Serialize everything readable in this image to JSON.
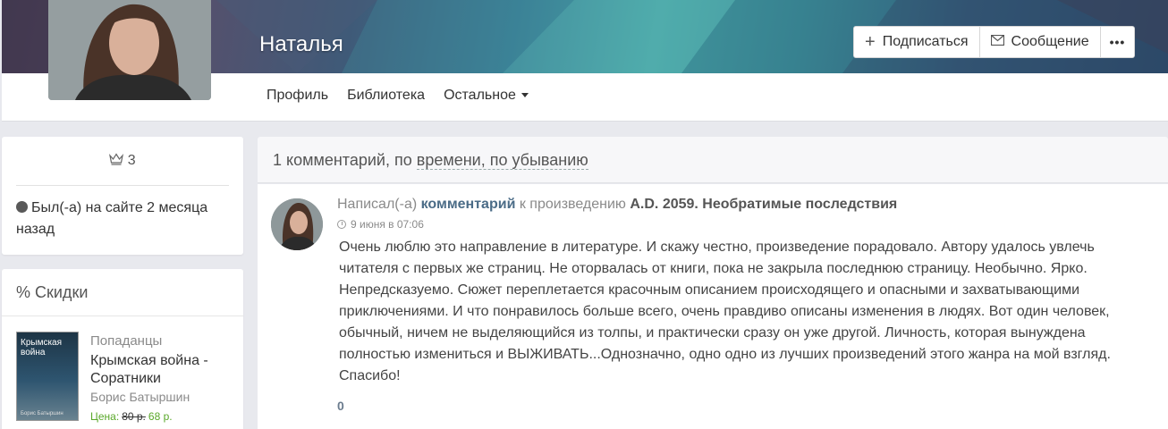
{
  "profile": {
    "name": "Наталья",
    "actions": {
      "subscribe": "Подписаться",
      "message": "Сообщение",
      "more": "•••"
    },
    "nav": {
      "profile": "Профиль",
      "library": "Библиотека",
      "other": "Остальное"
    }
  },
  "sidebar": {
    "rank": "3",
    "status": "Был(-а) на сайте 2 месяца назад",
    "discounts": {
      "title": "% Скидки",
      "book": {
        "cover_title": "Крымская война",
        "cover_author": "Борис Батыршин",
        "genre": "Попаданцы",
        "title": "Крымская война - Соратники",
        "author": "Борис Батыршин",
        "price_label": "Цена:",
        "old_price": "80 р.",
        "new_price": "68 р."
      }
    }
  },
  "main": {
    "sort_prefix": "1 комментарий, по",
    "sort_link": "времени, по убыванию",
    "comment": {
      "wrote": "Написал(-а)",
      "comment_link": "комментарий",
      "to_work": "к произведению",
      "work_title": "A.D. 2059. Необратимые последствия",
      "time": "9 июня в 07:06",
      "text": "Очень люблю это направление в литературе. И скажу честно, произведение порадовало. Автору удалось увлечь читателя с первых же страниц. Не оторвалась от книги, пока не закрыла последнюю страницу. Необычно. Ярко. Непредсказуемо. Сюжет переплетается красочным описанием происходящего и опасными и захватывающими приключениями. И что понравилось больше всего, очень правдиво описаны изменения в людях. Вот один человек, обычный, ничем не выделяющийся из толпы, и практически сразу он уже другой. Личность, которая вынуждена полностью измениться и ВЫЖИВАТЬ...Однозначно, одно одно из лучших произведений этого жанра на мой взгляд. Спасибо!",
      "rating": "0"
    }
  }
}
